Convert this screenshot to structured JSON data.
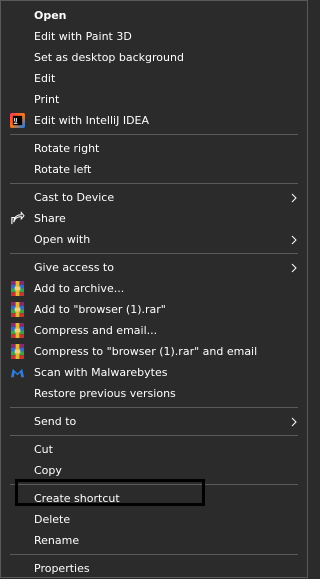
{
  "menu": {
    "items": [
      {
        "label": "Open"
      },
      {
        "label": "Edit with Paint 3D"
      },
      {
        "label": "Set as desktop background"
      },
      {
        "label": "Edit"
      },
      {
        "label": "Print"
      },
      {
        "label": "Edit with IntelliJ IDEA"
      },
      {
        "label": "Rotate right"
      },
      {
        "label": "Rotate left"
      },
      {
        "label": "Cast to Device"
      },
      {
        "label": "Share"
      },
      {
        "label": "Open with"
      },
      {
        "label": "Give access to"
      },
      {
        "label": "Add to archive..."
      },
      {
        "label": "Add to \"browser (1).rar\""
      },
      {
        "label": "Compress and email..."
      },
      {
        "label": "Compress to \"browser (1).rar\" and email"
      },
      {
        "label": "Scan with Malwarebytes"
      },
      {
        "label": "Restore previous versions"
      },
      {
        "label": "Send to"
      },
      {
        "label": "Cut"
      },
      {
        "label": "Copy"
      },
      {
        "label": "Create shortcut"
      },
      {
        "label": "Delete"
      },
      {
        "label": "Rename"
      },
      {
        "label": "Properties"
      }
    ]
  },
  "colors": {
    "background": "#2b2b2b",
    "text": "#ffffff",
    "separator": "#5a5a5a",
    "highlight_border": "#000000"
  }
}
